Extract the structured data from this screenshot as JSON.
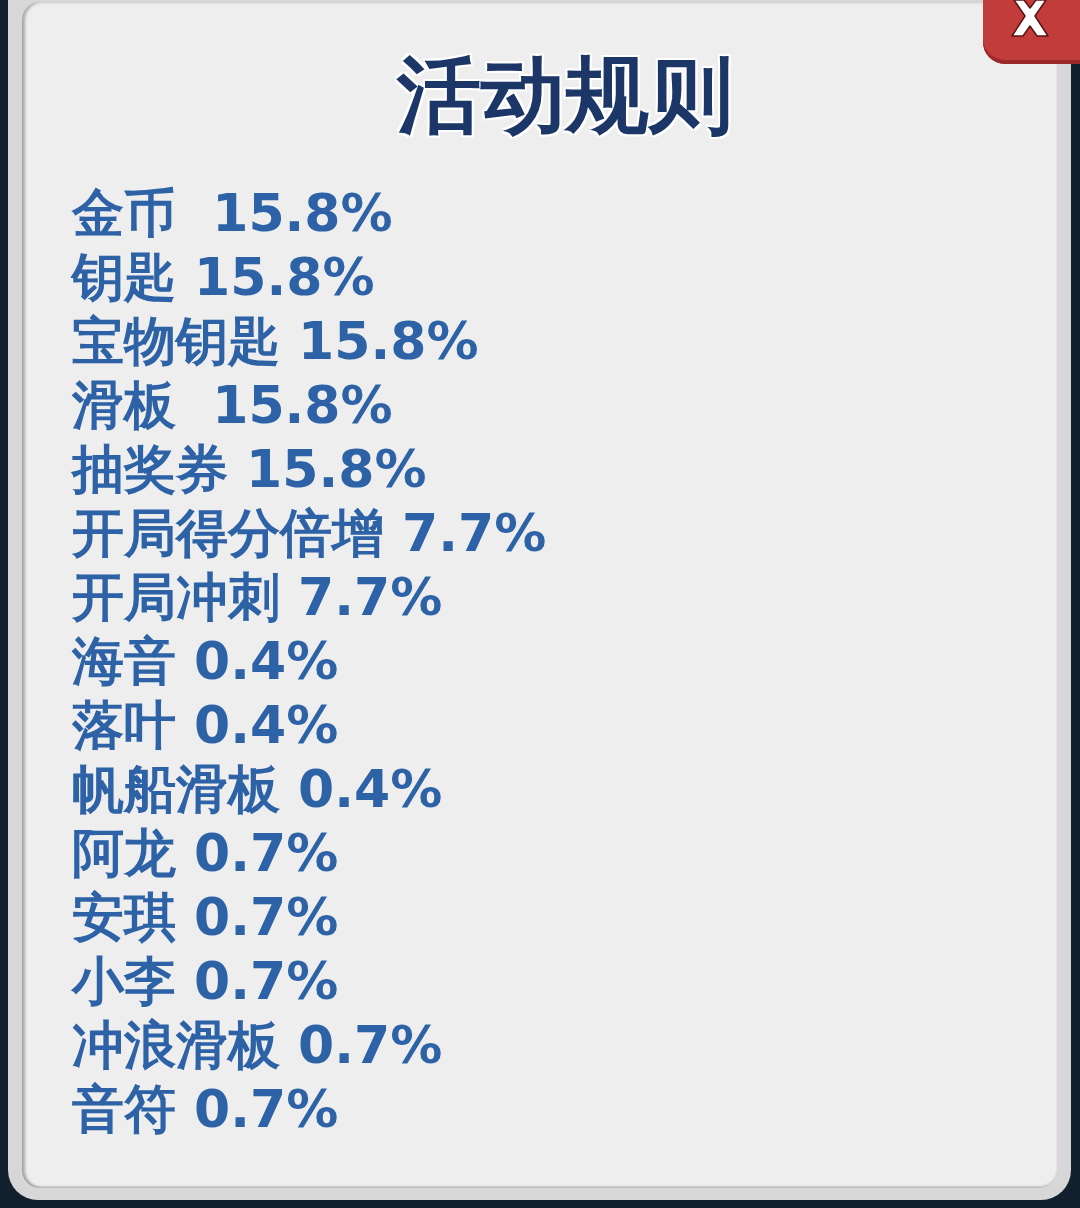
{
  "dialog": {
    "title": "活动规则",
    "rates": [
      "金币  15.8%",
      "钥匙 15.8%",
      "宝物钥匙 15.8%",
      "滑板  15.8%",
      "抽奖券 15.8%",
      "开局得分倍增 7.7%",
      "开局冲刺 7.7%",
      "海音 0.4%",
      "落叶 0.4%",
      "帆船滑板 0.4%",
      "阿龙 0.7%",
      "安琪 0.7%",
      "小李 0.7%",
      "冲浪滑板 0.7%",
      "音符 0.7%"
    ]
  }
}
